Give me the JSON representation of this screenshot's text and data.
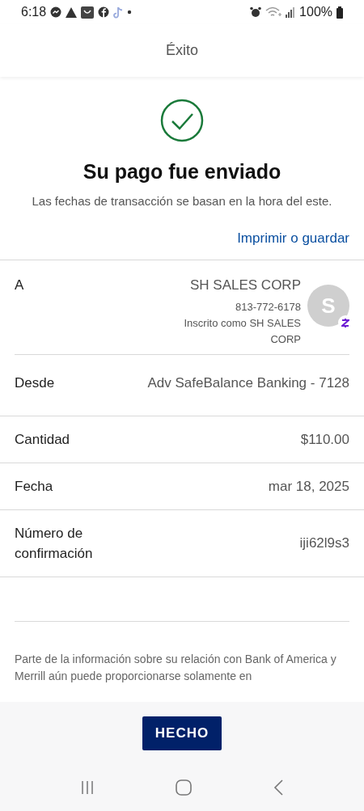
{
  "status_bar": {
    "time": "6:18",
    "battery": "100%"
  },
  "header": {
    "title": "Éxito"
  },
  "confirmation": {
    "title": "Su pago fue enviado",
    "subtitle": "Las fechas de transacción se basan en la hora del este.",
    "print_link": "Imprimir o guardar"
  },
  "details": [
    {
      "kind": "recipient",
      "label": "A",
      "name": "SH SALES CORP",
      "phone": "813-772-6178",
      "enrolled": "Inscrito como SH SALES CORP",
      "avatar": "S"
    },
    {
      "kind": "plain",
      "label": "Desde",
      "value": "Adv SafeBalance Banking - 7128"
    },
    {
      "kind": "plain",
      "label": "Cantidad",
      "value": "$110.00"
    },
    {
      "kind": "plain",
      "label": "Fecha",
      "value": "mar 18, 2025"
    },
    {
      "kind": "plain",
      "label": "Número de confirmación",
      "value": "iji62l9s3"
    }
  ],
  "disclaimer": "Parte de la información sobre su relación con Bank of America y Merrill aún puede proporcionarse solamente en",
  "done_button": "HECHO"
}
